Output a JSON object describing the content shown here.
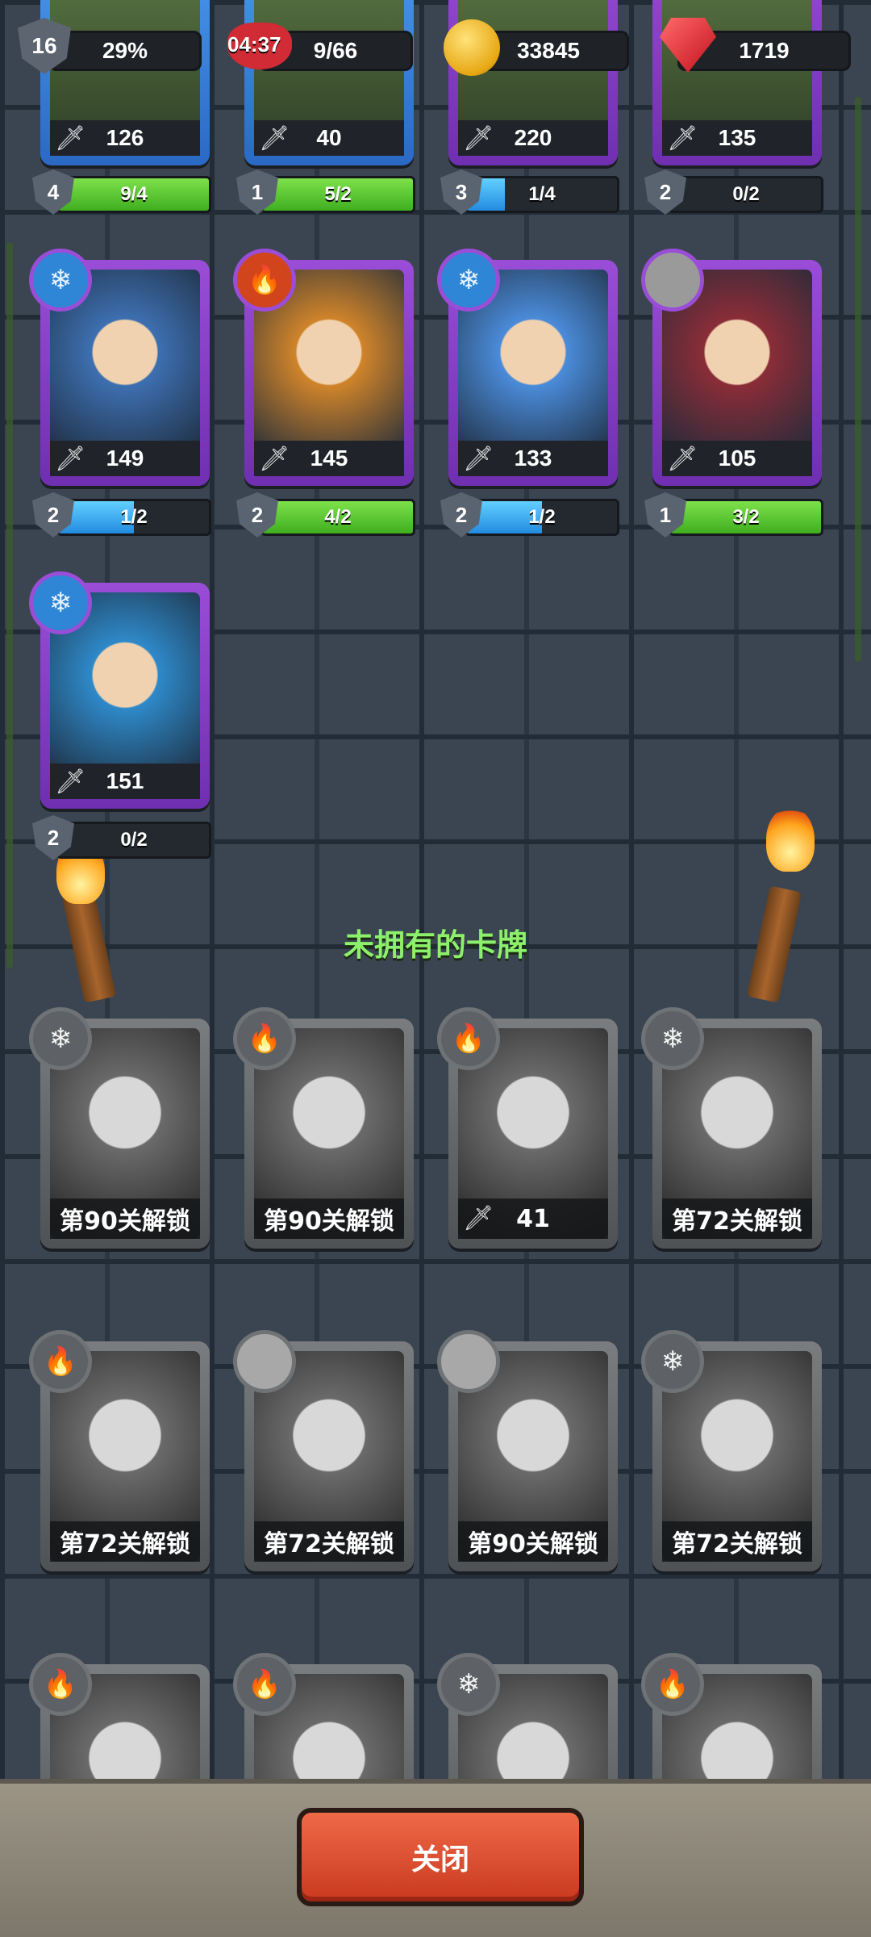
{
  "hud": {
    "player_level": "16",
    "xp_percent": "29%",
    "timer": "04:37",
    "energy": "9/66",
    "coins": "33845",
    "gems": "1719"
  },
  "owned_row0": [
    {
      "power": "126",
      "level": "4",
      "progress": "9/4",
      "fill": 1.0,
      "bar": "green"
    },
    {
      "power": "40",
      "level": "1",
      "progress": "5/2",
      "fill": 1.0,
      "bar": "green"
    },
    {
      "power": "220",
      "level": "3",
      "progress": "1/4",
      "fill": 0.25,
      "bar": "blue"
    },
    {
      "power": "135",
      "level": "2",
      "progress": "0/2",
      "fill": 0.0,
      "bar": "blue"
    }
  ],
  "owned": [
    {
      "element": "ice",
      "power": "149",
      "level": "2",
      "progress": "1/2",
      "fill": 0.5,
      "bar": "blue",
      "art": "#3d6fb0"
    },
    {
      "element": "fire",
      "power": "145",
      "level": "2",
      "progress": "4/2",
      "fill": 1.0,
      "bar": "green",
      "art": "#d0842a"
    },
    {
      "element": "ice",
      "power": "133",
      "level": "2",
      "progress": "1/2",
      "fill": 0.5,
      "bar": "blue",
      "art": "#4a8bd9"
    },
    {
      "element": "stone",
      "power": "105",
      "level": "1",
      "progress": "3/2",
      "fill": 1.0,
      "bar": "green",
      "art": "#8a2d38"
    },
    {
      "element": "ice",
      "power": "151",
      "level": "2",
      "progress": "0/2",
      "fill": 0.0,
      "bar": "blue",
      "art": "#2e89c9"
    }
  ],
  "unowned_title": "未拥有的卡牌",
  "unowned": [
    {
      "element": "ice",
      "label": "第90关解锁"
    },
    {
      "element": "fire",
      "label": "第90关解锁"
    },
    {
      "element": "fire",
      "label": "41"
    },
    {
      "element": "ice",
      "label": "第72关解锁"
    },
    {
      "element": "fire",
      "label": "第72关解锁"
    },
    {
      "element": "stone",
      "label": "第72关解锁"
    },
    {
      "element": "stone",
      "label": "第90关解锁"
    },
    {
      "element": "ice",
      "label": "第72关解锁"
    },
    {
      "element": "fire",
      "label": ""
    },
    {
      "element": "fire",
      "label": ""
    },
    {
      "element": "ice",
      "label": ""
    },
    {
      "element": "fire",
      "label": ""
    }
  ],
  "close_label": "关闭",
  "icons": {
    "ice": "snowflake-icon",
    "fire": "fire-icon",
    "stone": "stone-icon"
  }
}
